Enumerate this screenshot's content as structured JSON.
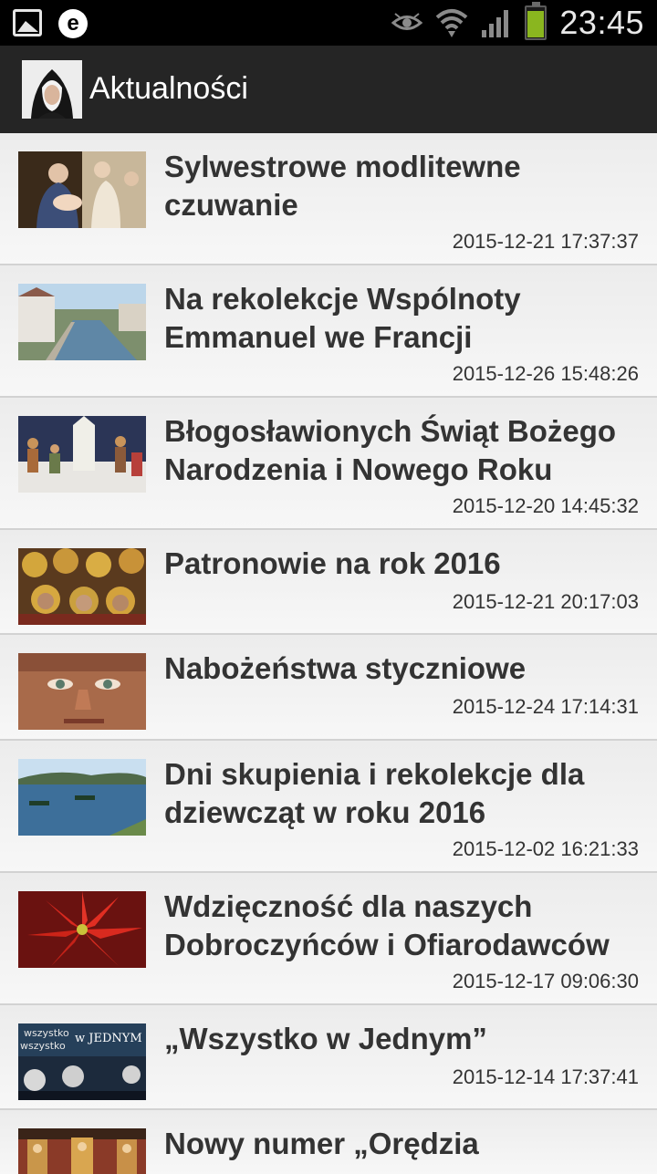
{
  "status_bar": {
    "time": "23:45",
    "left_icons": [
      "gallery-icon",
      "e-app-icon"
    ],
    "right_icons": [
      "eye-icon",
      "wifi-icon",
      "signal-icon",
      "battery-icon"
    ],
    "battery_color": "#8ab61f",
    "battery_level": 0.85
  },
  "action_bar": {
    "title": "Aktualności",
    "background": "#252525"
  },
  "news": [
    {
      "title_line1": "Sylwestrowe modlitewne",
      "title_line2": "czuwanie",
      "date": "2015-12-21 17:37:37",
      "thumb": "nativity-painting"
    },
    {
      "title_line1": "Na rekolekcje Wspólnoty",
      "title_line2": "Emmanuel we Francji",
      "date": "2015-12-26 15:48:26",
      "thumb": "canal-town"
    },
    {
      "title_line1": "Błogosławionych Świąt Bożego",
      "title_line2": "Narodzenia i Nowego Roku",
      "date": "2015-12-20 14:45:32",
      "thumb": "nativity-scene"
    },
    {
      "title_line1": "Patronowie na rok 2016",
      "title_line2": "",
      "date": "2015-12-21 20:17:03",
      "thumb": "saints-icons"
    },
    {
      "title_line1": "Nabożeństwa styczniowe",
      "title_line2": "",
      "date": "2015-12-24 17:14:31",
      "thumb": "face-portrait"
    },
    {
      "title_line1": "Dni skupienia i rekolekcje dla",
      "title_line2": "dziewcząt w roku 2016",
      "date": "2015-12-02 16:21:33",
      "thumb": "lake-boats"
    },
    {
      "title_line1": "Wdzięczność dla naszych",
      "title_line2": "Dobroczyńców i Ofiarodawców",
      "date": "2015-12-17 09:06:30",
      "thumb": "poinsettia"
    },
    {
      "title_line1": "„Wszystko w Jednym”",
      "title_line2": "",
      "date": "2015-12-14 17:37:41",
      "thumb": "wszystko-poster"
    },
    {
      "title_line1": "Nowy numer „Orędzia",
      "title_line2": "",
      "date": "",
      "thumb": "church-interior"
    }
  ]
}
